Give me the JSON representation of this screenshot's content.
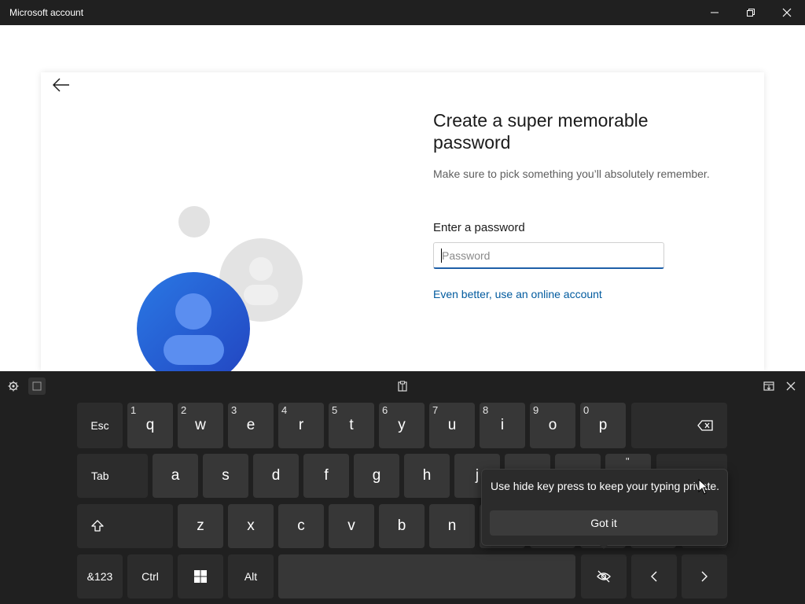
{
  "window": {
    "title": "Microsoft account"
  },
  "page": {
    "heading": "Create a super memorable password",
    "subtitle": "Make sure to pick something you’ll absolutely remember.",
    "field_label": "Enter a password",
    "password_placeholder": "Password",
    "online_account_link": "Even better, use an online account"
  },
  "keyboard": {
    "row1": [
      {
        "label": "Esc",
        "alt": ""
      },
      {
        "label": "q",
        "alt": "1"
      },
      {
        "label": "w",
        "alt": "2"
      },
      {
        "label": "e",
        "alt": "3"
      },
      {
        "label": "r",
        "alt": "4"
      },
      {
        "label": "t",
        "alt": "5"
      },
      {
        "label": "y",
        "alt": "6"
      },
      {
        "label": "u",
        "alt": "7"
      },
      {
        "label": "i",
        "alt": "8"
      },
      {
        "label": "o",
        "alt": "9"
      },
      {
        "label": "p",
        "alt": "0"
      }
    ],
    "row2": [
      {
        "label": "Tab"
      },
      {
        "label": "a"
      },
      {
        "label": "s"
      },
      {
        "label": "d"
      },
      {
        "label": "f"
      },
      {
        "label": "g"
      },
      {
        "label": "h"
      },
      {
        "label": "j"
      }
    ],
    "row3": [
      {
        "label": "z"
      },
      {
        "label": "x"
      },
      {
        "label": "c"
      },
      {
        "label": "v"
      },
      {
        "label": "b"
      },
      {
        "label": "n"
      }
    ],
    "row4": [
      {
        "label": "&123"
      },
      {
        "label": "Ctrl"
      },
      {
        "label": "Alt"
      }
    ],
    "hidden_key_hint": "\""
  },
  "tooltip": {
    "message": "Use hide key press to keep your typing private.",
    "button": "Got it"
  },
  "colors": {
    "accent": "#005a9e",
    "avatar_blue": "#1f66d6",
    "keyboard_bg": "#202020",
    "key_bg": "#373737"
  }
}
